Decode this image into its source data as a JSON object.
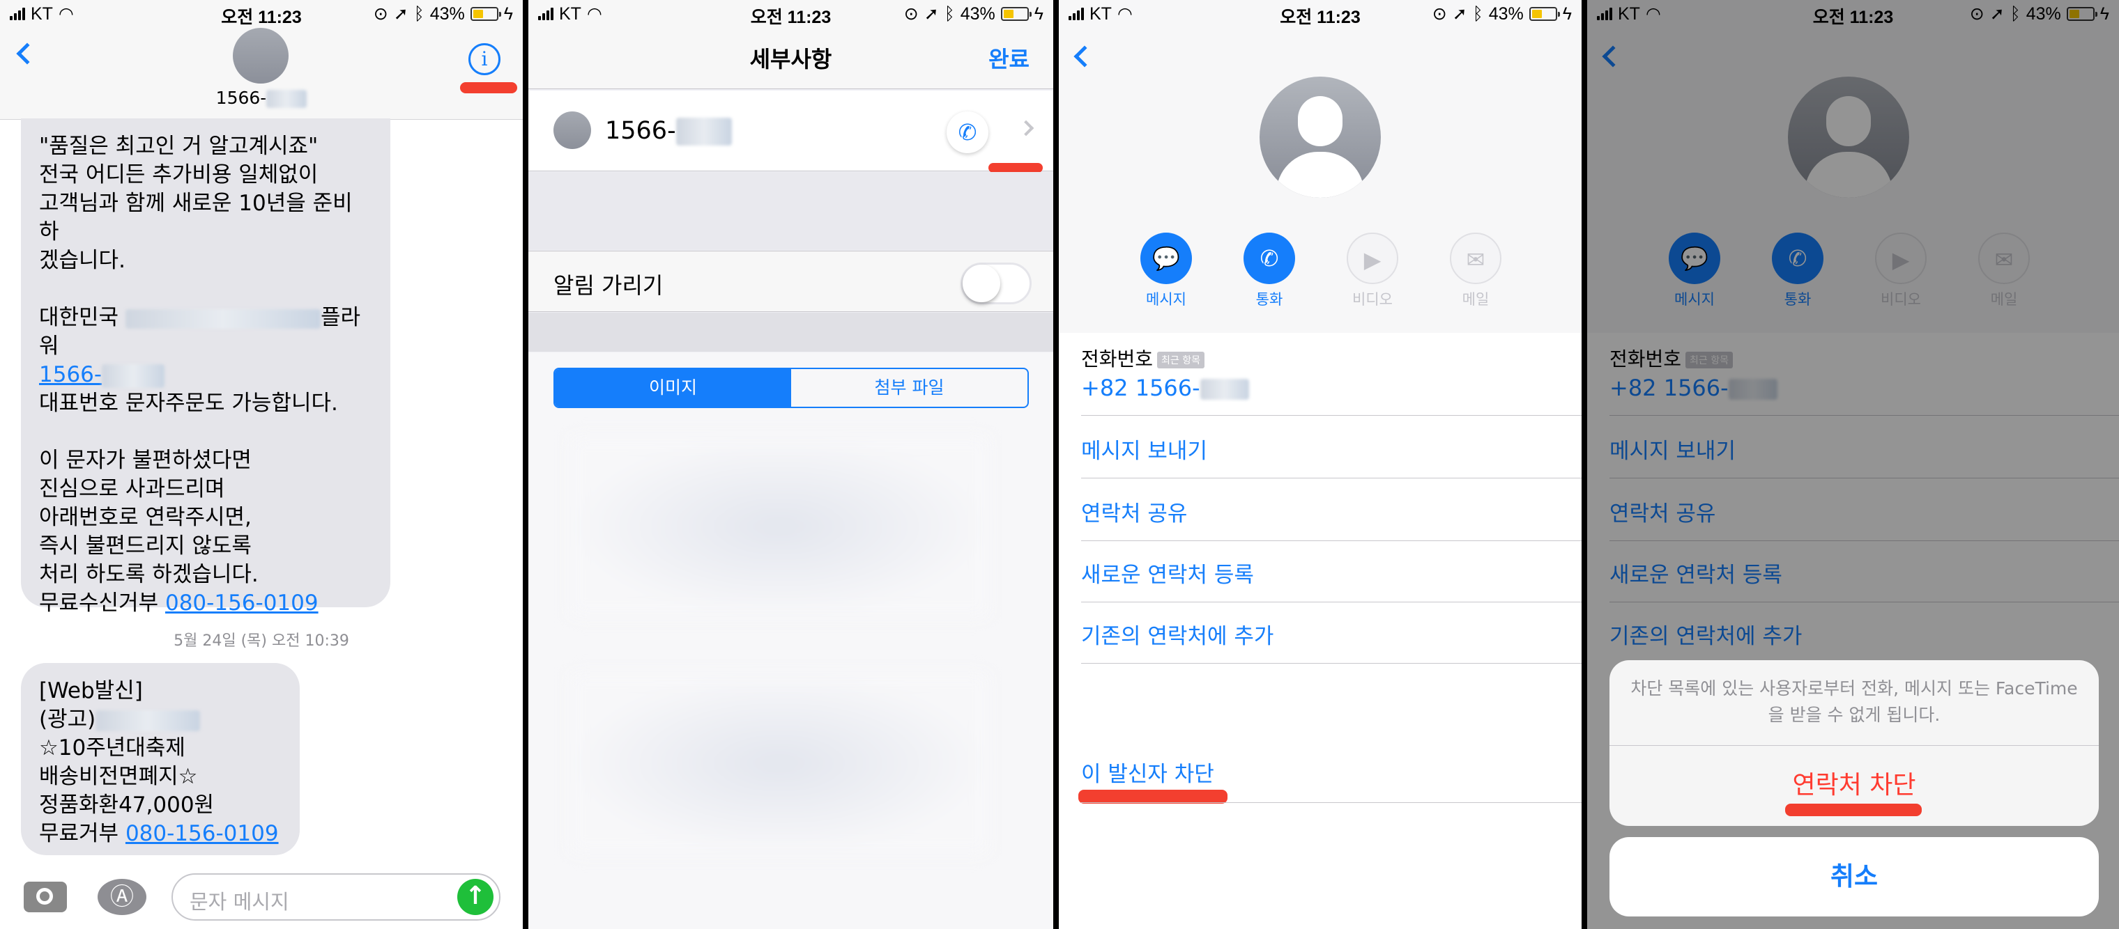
{
  "status": {
    "carrier": "KT",
    "time": "오전 11:23",
    "battery": "43%"
  },
  "screen1": {
    "title": "1566-",
    "info_icon": "i",
    "bubble1": "\"품질은  최고인 거  알고계시죠\"\n전국 어디든 추가비용 일체없이\n고객님과 함께 새로운 10년을 준비하\n겠습니다.\n\n대한민국",
    "bubble1_b": "플라\n워",
    "bubble1_link": "1566-",
    "bubble1_c": "대표번호 문자주문도 가능합니다.\n\n이 문자가 불편하셨다면\n진심으로 사과드리며\n아래번호로 연락주시면,\n즉시 불편드리지 않도록\n처리 하도록 하겠습니다.\n무료수신거부 ",
    "bubble1_phone": "080-156-0109",
    "timestamp": "5월 24일 (목) 오전 10:39",
    "bubble2": "[Web발신]\n(광고)",
    "bubble2_b": "\n☆10주년대축제\n배송비전면폐지☆\n정품화환47,000원\n무료거부 ",
    "bubble2_phone": "080-156-0109",
    "input_placeholder": "문자 메시지"
  },
  "screen2": {
    "title": "세부사항",
    "done": "완료",
    "contact_number": "1566-",
    "hide_alerts": "알림 가리기",
    "segments": [
      "이미지",
      "첨부 파일"
    ]
  },
  "contact": {
    "actions": [
      {
        "label": "메시지",
        "icon": "message-icon",
        "glyph": "💬"
      },
      {
        "label": "통화",
        "icon": "phone-icon",
        "glyph": "✆"
      },
      {
        "label": "비디오",
        "icon": "video-icon",
        "glyph": "▶"
      },
      {
        "label": "메일",
        "icon": "mail-icon",
        "glyph": "✉"
      }
    ],
    "phone_label": "전화번호",
    "recent_badge": "최근 항목",
    "phone_number": "+82 1566-",
    "items": [
      "메시지 보내기",
      "연락처 공유",
      "새로운 연락처 등록",
      "기존의 연락처에 추가"
    ],
    "block_caller": "이 발신자 차단"
  },
  "sheet": {
    "message": "차단 목록에 있는 사용자로부터 전화, 메시지 또는 FaceTime을 받을 수 없게 됩니다.",
    "block_contact": "연락처 차단",
    "cancel": "취소"
  }
}
